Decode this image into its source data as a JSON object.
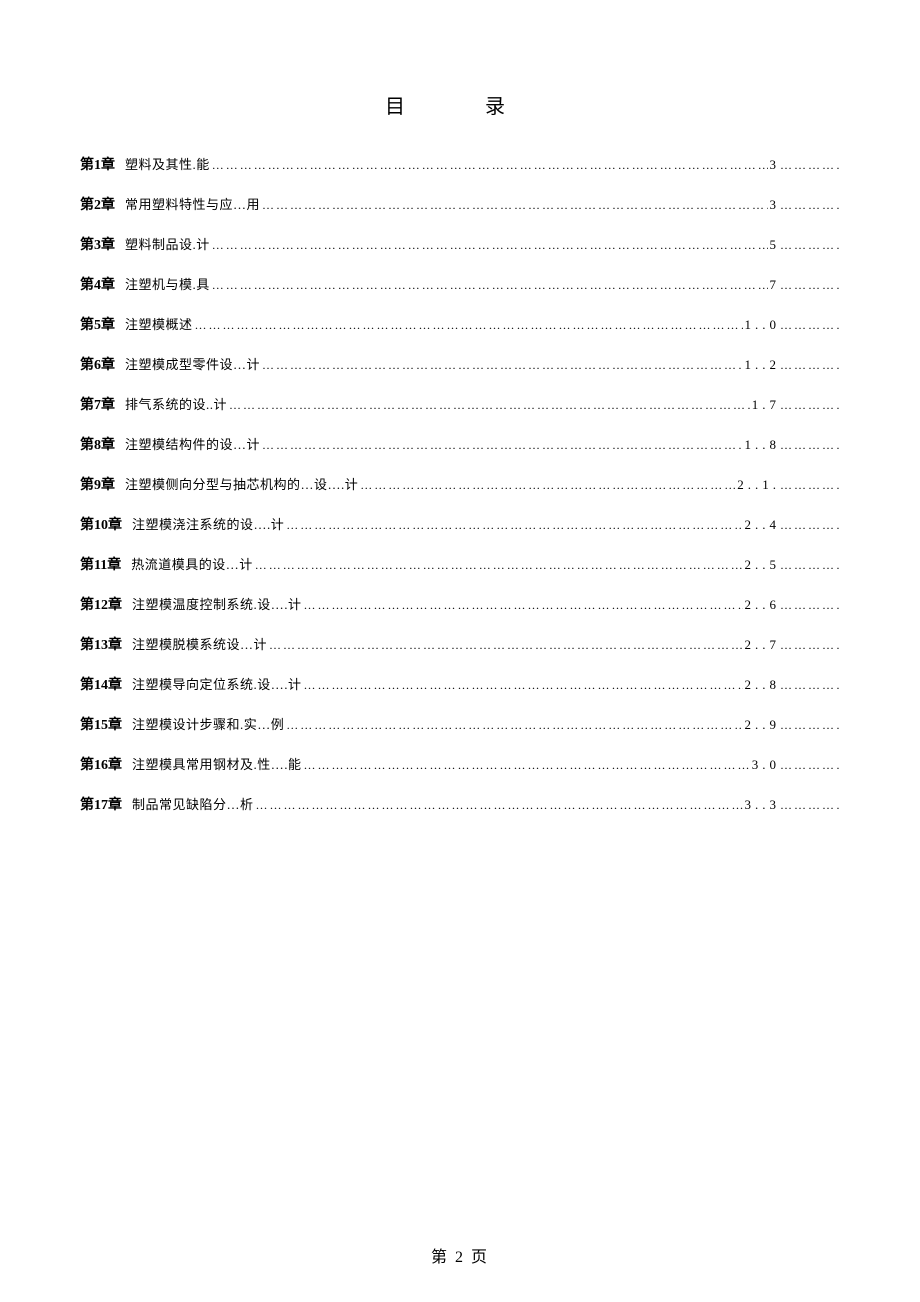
{
  "title": "目　录",
  "footer": "第 2 页",
  "entries": [
    {
      "chapter": "第1章",
      "topic": "塑料及其性.能",
      "page": "3"
    },
    {
      "chapter": "第2章",
      "topic": "常用塑料特性与应…用",
      "page": "3"
    },
    {
      "chapter": "第3章",
      "topic": "塑料制品设.计",
      "page": "5"
    },
    {
      "chapter": "第4章",
      "topic": "注塑机与模.具",
      "page": "7"
    },
    {
      "chapter": "第5章",
      "topic": "注塑模概述",
      "page": "1..0"
    },
    {
      "chapter": "第6章",
      "topic": "注塑模成型零件设…计",
      "page": "1..2"
    },
    {
      "chapter": "第7章",
      "topic": "排气系统的设..计",
      "page": "1.7"
    },
    {
      "chapter": "第8章",
      "topic": "注塑模结构件的设…计",
      "page": "1..8"
    },
    {
      "chapter": "第9章",
      "topic": "注塑模侧向分型与抽芯机构的…设….计",
      "page": "2..1."
    },
    {
      "chapter": "第10章",
      "topic": "注塑模浇注系统的设….计",
      "page": "2..4"
    },
    {
      "chapter": "第11章",
      "topic": "热流道模具的设…计",
      "page": "2..5"
    },
    {
      "chapter": "第12章",
      "topic": "注塑模温度控制系统.设….计",
      "page": "2..6"
    },
    {
      "chapter": "第13章",
      "topic": "注塑模脱模系统设…计",
      "page": "2..7"
    },
    {
      "chapter": "第14章",
      "topic": "注塑模导向定位系统.设….计",
      "page": "2..8"
    },
    {
      "chapter": "第15章",
      "topic": "注塑模设计步骤和.实…例",
      "page": "2..9"
    },
    {
      "chapter": "第16章",
      "topic": "注塑模具常用钢材及.性….能",
      "page": "3.0"
    },
    {
      "chapter": "第17章",
      "topic": "制品常见缺陷分…析",
      "page": "3..3"
    }
  ]
}
